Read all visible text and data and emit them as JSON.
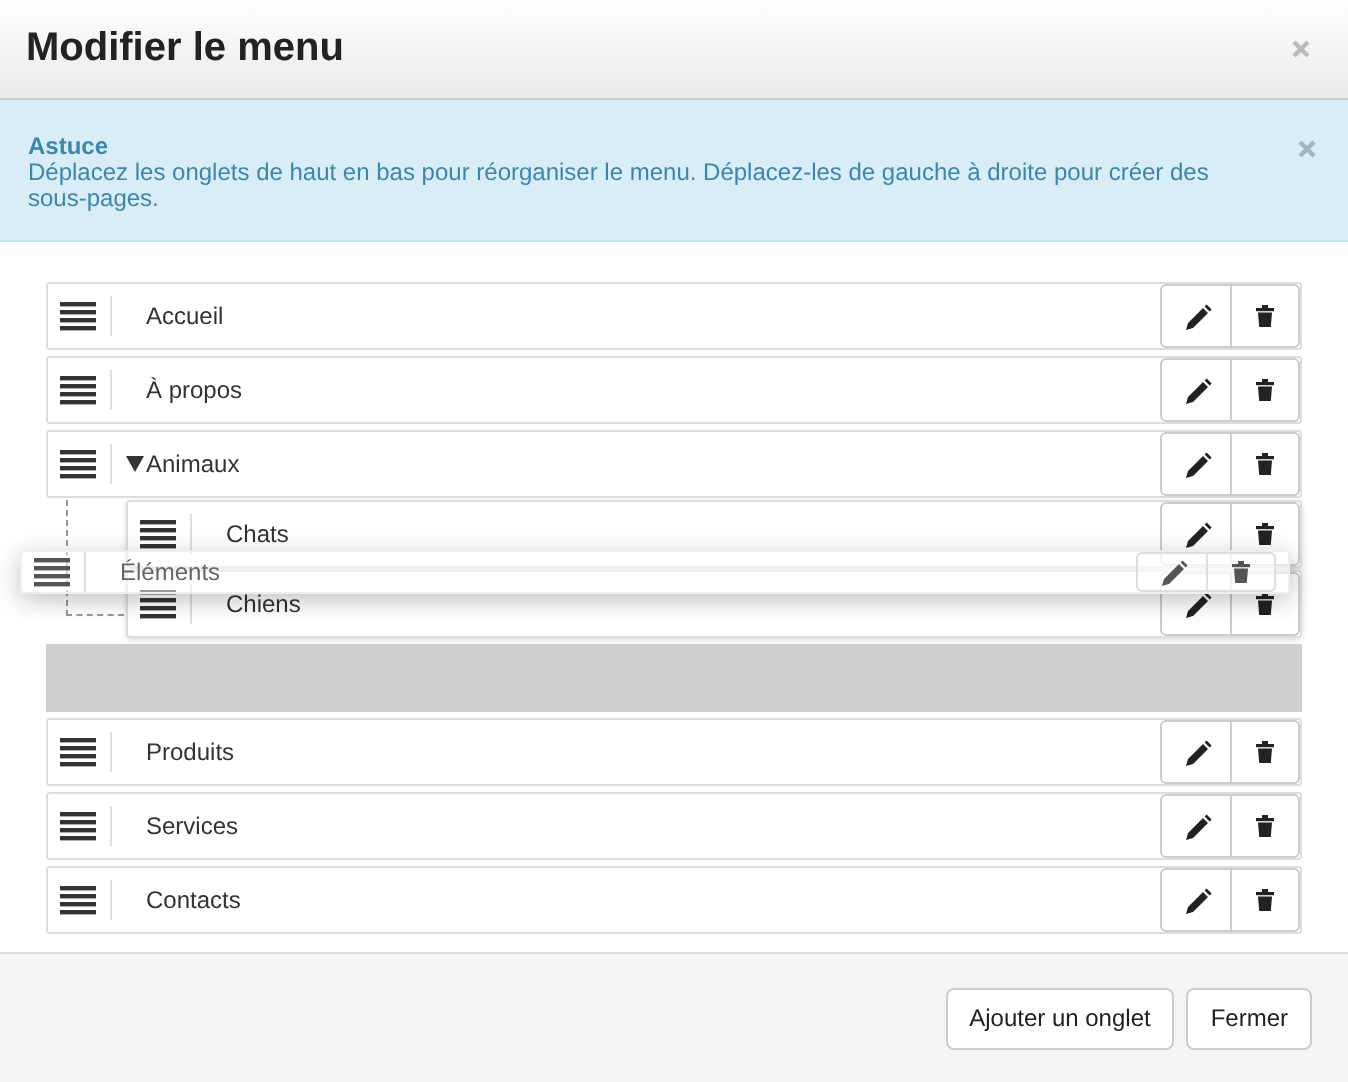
{
  "dialog": {
    "title": "Modifier le menu"
  },
  "tip": {
    "title": "Astuce",
    "text": "Déplacez les onglets de haut en bas pour réorganiser le menu. Déplacez-les de gauche à droite pour créer des sous-pages."
  },
  "menu_items": [
    {
      "kind": "tab",
      "label": "Accueil"
    },
    {
      "kind": "tab",
      "label": "À propos"
    },
    {
      "kind": "tab",
      "label": "Animaux",
      "expanded": true,
      "children": [
        {
          "kind": "tab",
          "label": "Chats"
        },
        {
          "kind": "tab",
          "label": "Chiens"
        }
      ]
    },
    {
      "kind": "placeholder"
    },
    {
      "kind": "tab",
      "label": "Produits"
    },
    {
      "kind": "tab",
      "label": "Services"
    },
    {
      "kind": "tab",
      "label": "Contacts"
    }
  ],
  "dragging": {
    "label": "Éléments"
  },
  "buttons": [
    "Ajouter un onglet",
    "Fermer"
  ]
}
